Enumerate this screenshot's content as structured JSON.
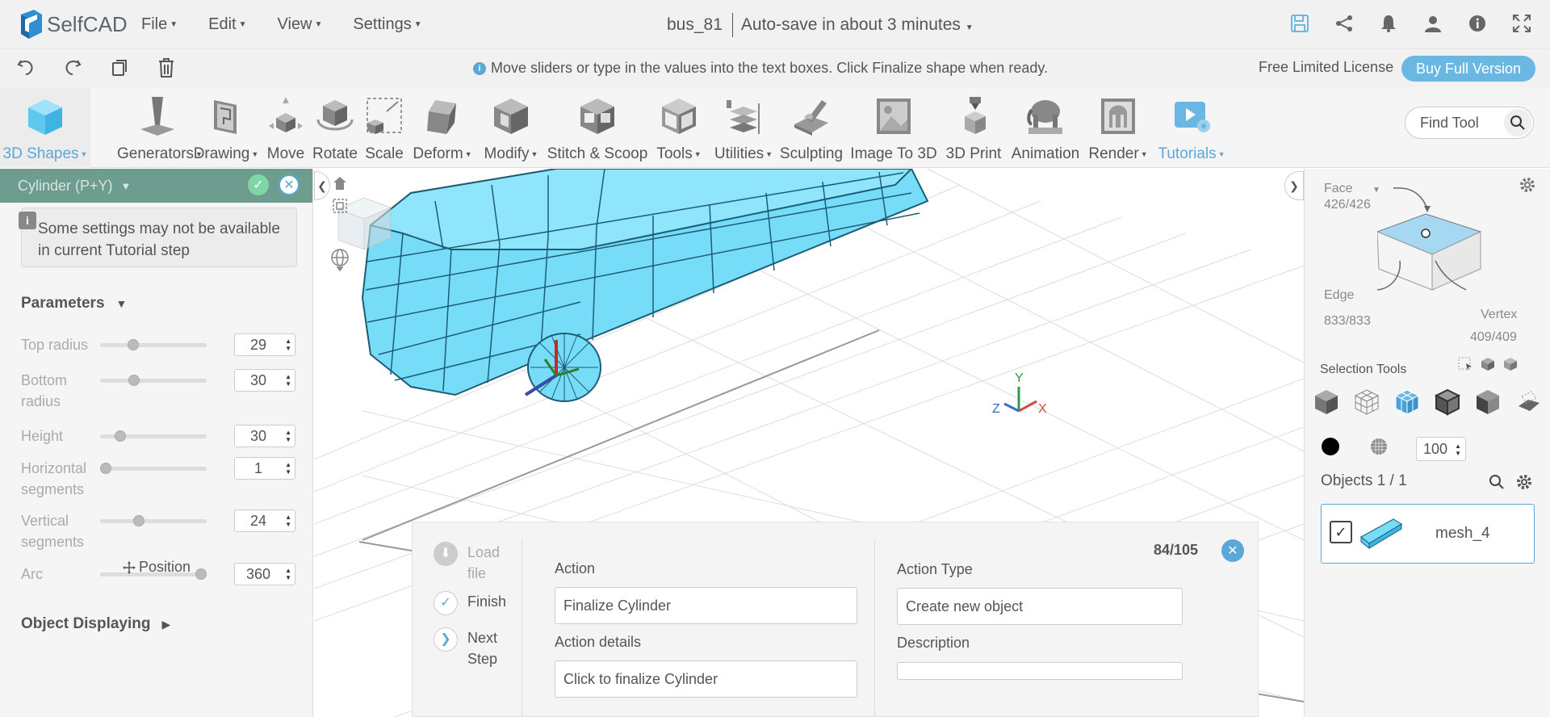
{
  "app": {
    "name": "SelfCAD",
    "doc_name": "bus_81",
    "autosave": "Auto-save in about 3 minutes"
  },
  "menu": [
    "File",
    "Edit",
    "View",
    "Settings"
  ],
  "hint": "Move sliders or type in the values into the text boxes. Click Finalize shape when ready.",
  "license": "Free Limited License",
  "buy_label": "Buy Full Version",
  "ribbon": [
    {
      "label": "3D Shapes",
      "dropdown": true
    },
    {
      "label": "Generators",
      "dropdown": true
    },
    {
      "label": "Drawing",
      "dropdown": true
    },
    {
      "label": "Move",
      "dropdown": false
    },
    {
      "label": "Rotate",
      "dropdown": false
    },
    {
      "label": "Scale",
      "dropdown": false
    },
    {
      "label": "Deform",
      "dropdown": true
    },
    {
      "label": "Modify",
      "dropdown": true
    },
    {
      "label": "Stitch & Scoop",
      "dropdown": false
    },
    {
      "label": "Tools",
      "dropdown": true
    },
    {
      "label": "Utilities",
      "dropdown": true
    },
    {
      "label": "Sculpting",
      "dropdown": false
    },
    {
      "label": "Image To 3D",
      "dropdown": false
    },
    {
      "label": "3D Print",
      "dropdown": false
    },
    {
      "label": "Animation",
      "dropdown": false
    },
    {
      "label": "Render",
      "dropdown": true
    },
    {
      "label": "Tutorials",
      "dropdown": true
    }
  ],
  "find_tool_placeholder": "Find Tool",
  "left_panel": {
    "title": "Cylinder (P+Y)",
    "notice": "Some settings may not be available in current Tutorial step",
    "parameters_title": "Parameters",
    "params": [
      {
        "label": "Top radius",
        "value": "29",
        "fraction": 0.29
      },
      {
        "label": "Bottom radius",
        "value": "30",
        "fraction": 0.3
      },
      {
        "label": "Height",
        "value": "30",
        "fraction": 0.15
      },
      {
        "label": "Horizontal segments",
        "value": "1",
        "fraction": 0.0
      },
      {
        "label": "Vertical segments",
        "value": "24",
        "fraction": 0.35
      },
      {
        "label": "Arc",
        "value": "360",
        "fraction": 1.0
      }
    ],
    "object_displaying": "Object Displaying",
    "position": "Position"
  },
  "tutorial": {
    "steps": {
      "load": "Load file",
      "finish": "Finish",
      "next": "Next Step"
    },
    "action_label": "Action",
    "action_value": "Finalize Cylinder",
    "action_details_label": "Action details",
    "action_details_value": "Click to finalize Cylinder",
    "action_type_label": "Action Type",
    "action_type_value": "Create new object",
    "description_label": "Description",
    "description_value": "",
    "counter": "84/105"
  },
  "right_panel": {
    "face_label": "Face",
    "face_count": "426/426",
    "edge_label": "Edge",
    "edge_count": "833/833",
    "vertex_label": "Vertex",
    "vertex_count": "409/409",
    "selection_tools": "Selection Tools",
    "opacity": "100",
    "objects_title": "Objects 1 / 1",
    "object_name": "mesh_4"
  },
  "axes": {
    "x": "X",
    "y": "Y",
    "z": "Z"
  },
  "colors": {
    "accent": "#5aa8d8",
    "header_green": "#6e9d8f",
    "mesh": "#76dcf8"
  }
}
